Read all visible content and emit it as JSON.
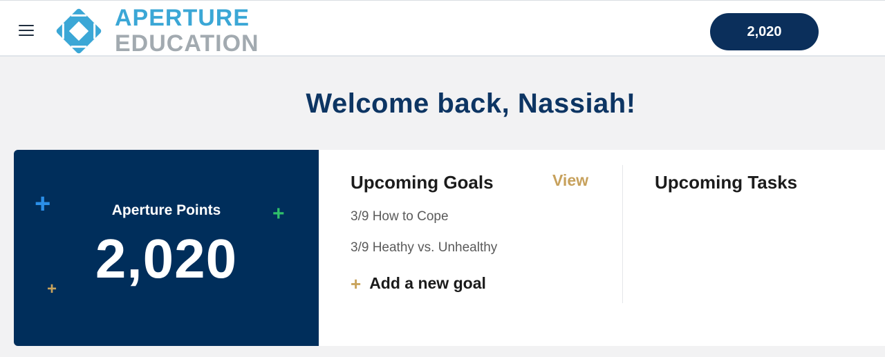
{
  "header": {
    "logo_line1": "APERTURE",
    "logo_line2": "EDUCATION",
    "points_pill": "2,020"
  },
  "welcome": "Welcome back, Nassiah!",
  "points_card": {
    "label": "Aperture Points",
    "value": "2,020"
  },
  "goals": {
    "title": "Upcoming Goals",
    "view_label": "View",
    "items": [
      {
        "label": "3/9 How to Cope"
      },
      {
        "label": "3/9 Heathy vs. Unhealthy"
      }
    ],
    "add_label": "Add a new goal"
  },
  "tasks": {
    "title": "Upcoming Tasks"
  },
  "colors": {
    "navy": "#002e5b",
    "accent_gold": "#c7a15c",
    "logo_blue": "#3ba7d6",
    "logo_gray": "#a2aab0"
  }
}
